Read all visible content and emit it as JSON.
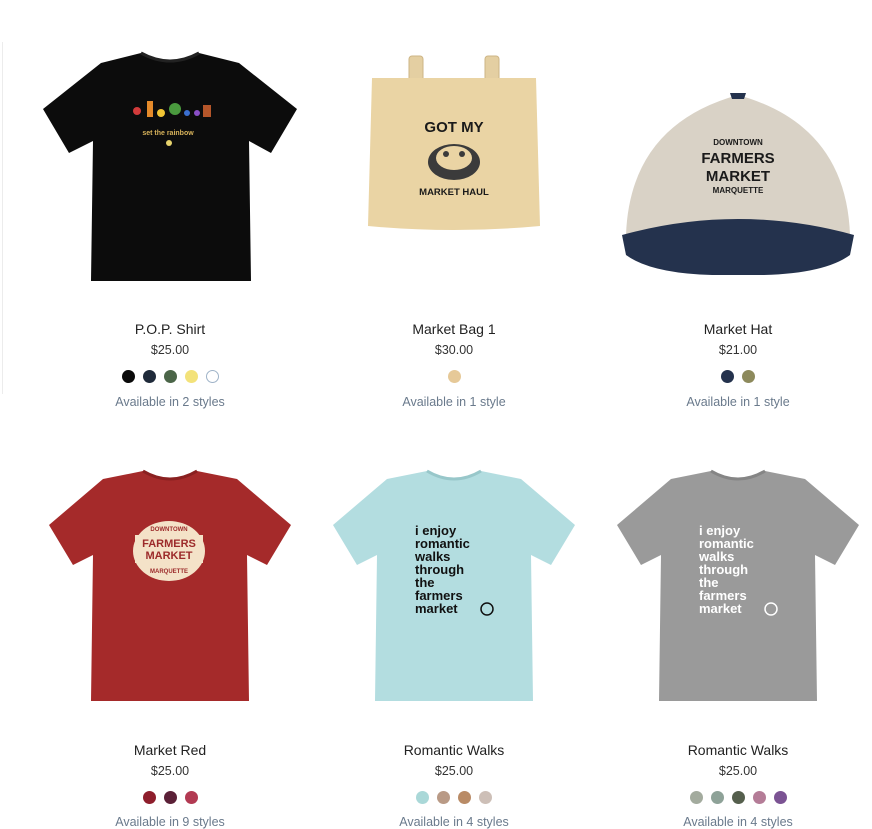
{
  "products": [
    {
      "name": "P.O.P. Shirt",
      "price": "$25.00",
      "styles": "Available in 2 styles",
      "swatches": [
        "#0a0a0a",
        "#1f2a3a",
        "#4b6548",
        "#f3e27a",
        "#ffffff"
      ],
      "art": "set the rainbow"
    },
    {
      "name": "Market Bag 1",
      "price": "$30.00",
      "styles": "Available in 1 style",
      "swatches": [
        "#e6c998"
      ],
      "art_top": "GOT MY",
      "art_bottom": "MARKET HAUL"
    },
    {
      "name": "Market Hat",
      "price": "$21.00",
      "styles": "Available in 1 style",
      "swatches": [
        "#24324d",
        "#8d8a5c"
      ],
      "art": [
        "DOWNTOWN",
        "FARMERS",
        "MARKET",
        "MARQUETTE"
      ]
    },
    {
      "name": "Market Red",
      "price": "$25.00",
      "styles": "Available in 9 styles",
      "swatches": [
        "#8e1e2c",
        "#5b2037",
        "#b23a52"
      ],
      "art": [
        "DOWNTOWN",
        "FARMERS",
        "MARKET",
        "MARQUETTE"
      ]
    },
    {
      "name": "Romantic Walks",
      "price": "$25.00",
      "styles": "Available in 4 styles",
      "swatches": [
        "#aad8d8",
        "#b99a86",
        "#b98b66",
        "#cdbfb7"
      ],
      "art": [
        "i enjoy",
        "romantic",
        "walks",
        "through",
        "the",
        "farmers",
        "market"
      ]
    },
    {
      "name": "Romantic Walks",
      "price": "$25.00",
      "styles": "Available in 4 styles",
      "swatches": [
        "#a3ab9e",
        "#8ea298",
        "#555f4d",
        "#b47c97",
        "#7b5393"
      ],
      "art": [
        "i enjoy",
        "romantic",
        "walks",
        "through",
        "the",
        "farmers",
        "market"
      ]
    }
  ]
}
